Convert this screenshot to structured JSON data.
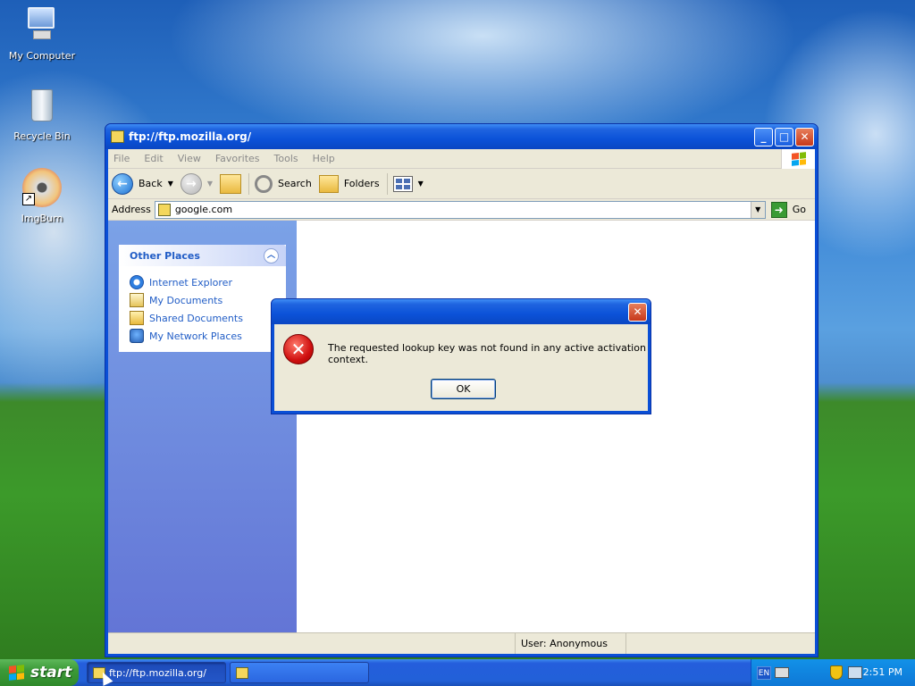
{
  "desktop": {
    "icons": [
      {
        "label": "My Computer",
        "icon": "my-computer-icon"
      },
      {
        "label": "Recycle Bin",
        "icon": "recycle-bin-icon"
      },
      {
        "label": "ImgBurn",
        "icon": "imgburn-disc-icon"
      }
    ]
  },
  "window": {
    "title": "ftp://ftp.mozilla.org/",
    "menu": [
      "File",
      "Edit",
      "View",
      "Favorites",
      "Tools",
      "Help"
    ],
    "toolbar": {
      "back_label": "Back",
      "search_label": "Search",
      "folders_label": "Folders"
    },
    "address": {
      "label": "Address",
      "value": "google.com",
      "go_label": "Go"
    },
    "taskpane": {
      "other_places_title": "Other Places",
      "items": [
        {
          "label": "Internet Explorer",
          "icon": "internet-explorer-icon"
        },
        {
          "label": "My Documents",
          "icon": "my-documents-icon"
        },
        {
          "label": "Shared Documents",
          "icon": "shared-documents-icon"
        },
        {
          "label": "My Network Places",
          "icon": "my-network-places-icon"
        }
      ]
    },
    "status": {
      "user": "User: Anonymous"
    }
  },
  "dialog": {
    "message": "The requested lookup key was not found in any active activation context.",
    "ok_label": "OK",
    "icon": "error-icon"
  },
  "taskbar": {
    "start_label": "start",
    "tasks": [
      {
        "label": "ftp://ftp.mozilla.org/",
        "active": true
      },
      {
        "label": "",
        "active": false
      }
    ],
    "tray": {
      "language": "EN",
      "time": "2:51 PM"
    }
  },
  "colors": {
    "xp_blue": "#0a4fd6",
    "start_green": "#3c9a38",
    "link_blue": "#215dc6",
    "error_red": "#d01010"
  }
}
